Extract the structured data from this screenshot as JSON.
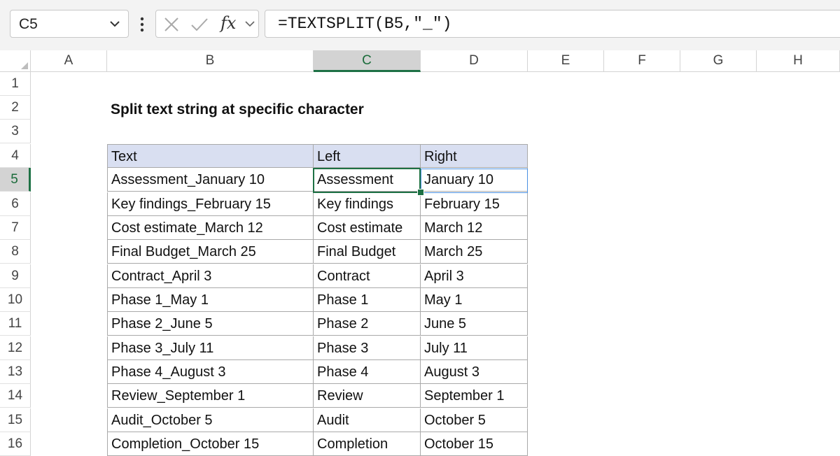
{
  "name_box": {
    "value": "C5"
  },
  "formula_bar": {
    "fx_label": "fx",
    "formula": "=TEXTSPLIT(B5,\"_\")"
  },
  "columns": [
    "A",
    "B",
    "C",
    "D",
    "E",
    "F",
    "G",
    "H"
  ],
  "selected_column": "C",
  "rows": [
    "1",
    "2",
    "3",
    "4",
    "5",
    "6",
    "7",
    "8",
    "9",
    "10",
    "11",
    "12",
    "13",
    "14",
    "15",
    "16"
  ],
  "selected_row": "5",
  "sheet": {
    "title": "Split text string at specific character",
    "table": {
      "headers": [
        "Text",
        "Left",
        "Right"
      ],
      "rows": [
        [
          "Assessment_January 10",
          "Assessment",
          "January 10"
        ],
        [
          "Key findings_February 15",
          "Key findings",
          "February 15"
        ],
        [
          "Cost estimate_March 12",
          "Cost estimate",
          "March 12"
        ],
        [
          "Final Budget_March 25",
          "Final Budget",
          "March 25"
        ],
        [
          "Contract_April 3",
          "Contract",
          "April 3"
        ],
        [
          "Phase 1_May 1",
          "Phase 1",
          "May 1"
        ],
        [
          "Phase 2_June 5",
          "Phase 2",
          "June 5"
        ],
        [
          "Phase 3_July 11",
          "Phase 3",
          "July 11"
        ],
        [
          "Phase 4_August 3",
          "Phase 4",
          "August 3"
        ],
        [
          "Review_September 1",
          "Review",
          "September 1"
        ],
        [
          "Audit_October 5",
          "Audit",
          "October 5"
        ],
        [
          "Completion_October 15",
          "Completion",
          "October 15"
        ]
      ]
    }
  },
  "colors": {
    "accent_green": "#1e7145",
    "table_header_bg": "#d9dff1",
    "spill_border": "#4a90e2"
  }
}
